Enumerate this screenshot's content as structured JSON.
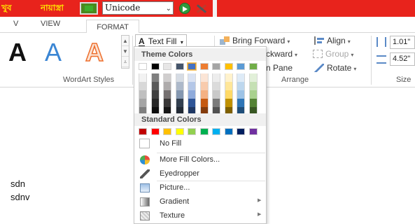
{
  "topbar": {
    "brand_text": "খুব",
    "script_text": "নায়াস্ত্রা",
    "font_combo_value": "Unicode",
    "combo_arrow": "⌄"
  },
  "ribbon_tabs": {
    "partial_tab": "V",
    "view": "VIEW",
    "format": "FORMAT"
  },
  "wordart": {
    "letter": "A",
    "group_label": "WordArt Styles",
    "scroll_up": "▲",
    "scroll_down": "▼",
    "scroll_more": "⩡"
  },
  "text_fill": {
    "icon_letter": "A",
    "label": "Text Fill",
    "dropdown": "▾"
  },
  "arrange": {
    "bring_forward": "Bring Forward",
    "send_backward": "ckward",
    "selection_pane": "n Pane",
    "align": "Align",
    "group": "Group",
    "rotate": "Rotate",
    "group_label": "Arrange",
    "dd": "▾"
  },
  "size": {
    "height_value": "1.01\"",
    "width_value": "4.52\"",
    "group_label": "Size"
  },
  "document": {
    "line1": "sdn",
    "line2": "sdnv"
  },
  "menu": {
    "theme_colors_label": "Theme Colors",
    "theme_top": [
      "#ffffff",
      "#000000",
      "#e7e6e6",
      "#44546a",
      "#4472c4",
      "#ed7d31",
      "#a5a5a5",
      "#ffc000",
      "#5b9bd5",
      "#70ad47"
    ],
    "theme_shades": [
      [
        "#f2f2f2",
        "#d8d8d8",
        "#bfbfbf",
        "#a5a5a5",
        "#7f7f7f"
      ],
      [
        "#7f7f7f",
        "#595959",
        "#3f3f3f",
        "#262626",
        "#0d0d0d"
      ],
      [
        "#d0cece",
        "#aeabab",
        "#757070",
        "#3a3838",
        "#171616"
      ],
      [
        "#d6dce4",
        "#adb9ca",
        "#8497b0",
        "#323f4f",
        "#222a35"
      ],
      [
        "#dae3f3",
        "#b4c7e7",
        "#8eaadb",
        "#2f5597",
        "#1f3864"
      ],
      [
        "#fbe5d6",
        "#f8cbad",
        "#f4b183",
        "#c55a11",
        "#843c0c"
      ],
      [
        "#ededed",
        "#dbdbdb",
        "#c9c9c9",
        "#7b7b7b",
        "#525252"
      ],
      [
        "#fff2cc",
        "#ffe699",
        "#ffd966",
        "#bf9000",
        "#7f6000"
      ],
      [
        "#deebf7",
        "#bdd7ee",
        "#9dc3e6",
        "#2e75b6",
        "#1f4e79"
      ],
      [
        "#e2f0d9",
        "#c5e0b4",
        "#a9d18e",
        "#548235",
        "#385723"
      ]
    ],
    "standard_colors_label": "Standard Colors",
    "standard_colors": [
      "#c00000",
      "#ff0000",
      "#ffc000",
      "#ffff00",
      "#92d050",
      "#00b050",
      "#00b0f0",
      "#0070c0",
      "#002060",
      "#7030a0"
    ],
    "selected_theme_index": 4,
    "no_fill": "No Fill",
    "more_fill_colors": "More Fill Colors...",
    "eyedropper": "Eyedropper",
    "picture": "Picture...",
    "gradient": "Gradient",
    "texture": "Texture",
    "submenu_arrow": "▶"
  },
  "colors": {
    "topbar_red": "#e8231c",
    "format_tab_accent": "#c44a1d"
  }
}
